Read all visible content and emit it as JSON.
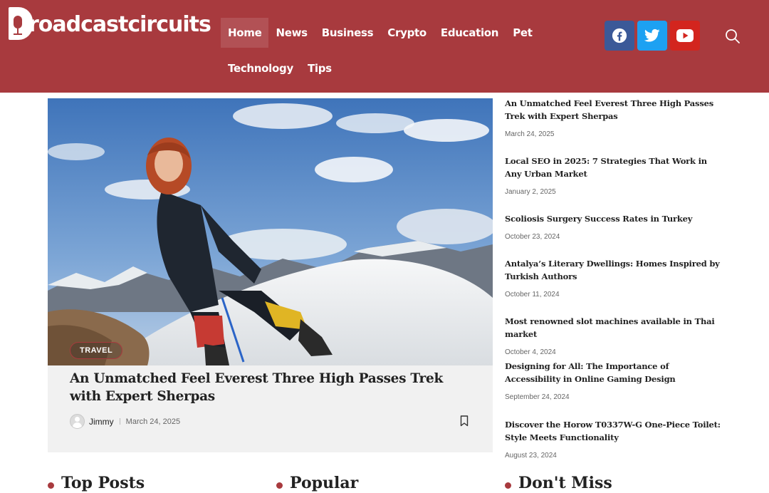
{
  "site": {
    "logo_text": "roadcastcircuits",
    "logo_alt": "Broadcastcircuits"
  },
  "nav": {
    "items": [
      {
        "label": "Home"
      },
      {
        "label": "News"
      },
      {
        "label": "Business"
      },
      {
        "label": "Crypto"
      },
      {
        "label": "Education"
      },
      {
        "label": "Pet"
      },
      {
        "label": "Technology"
      },
      {
        "label": "Tips"
      }
    ]
  },
  "social": {
    "icons": [
      "facebook-icon",
      "twitter-icon",
      "youtube-icon",
      "search-icon"
    ]
  },
  "featured": {
    "category": "TRAVEL",
    "title": "An Unmatched Feel Everest Three High Passes Trek with Expert Sherpas",
    "author": "Jimmy",
    "date": "March 24, 2025"
  },
  "sidebar": {
    "items": [
      {
        "title": "An Unmatched Feel Everest Three High Passes Trek with Expert Sherpas",
        "date": "March 24, 2025"
      },
      {
        "title": "Local SEO in 2025: 7 Strategies That Work in Any Urban Market",
        "date": "January 2, 2025"
      },
      {
        "title": "Scoliosis Surgery Success Rates in Turkey",
        "date": "October 23, 2024"
      },
      {
        "title": "Antalya’s Literary Dwellings: Homes Inspired by Turkish Authors",
        "date": "October 11, 2024"
      },
      {
        "title": "Most renowned slot machines available in Thai market",
        "date": "October 4, 2024"
      },
      {
        "title": "Designing for All: The Importance of Accessibility in Online Gaming Design",
        "date": "September 24, 2024"
      },
      {
        "title": "Discover the Horow T0337W-G One-Piece Toilet: Style Meets Functionality",
        "date": "August 23, 2024"
      }
    ]
  },
  "sections": [
    {
      "label": "Top Posts"
    },
    {
      "label": "Popular"
    },
    {
      "label": "Don't Miss"
    }
  ],
  "colors": {
    "brand": "#a83a3e",
    "facebook": "#3b5998",
    "twitter": "#1da1f2",
    "youtube": "#d3251e"
  }
}
